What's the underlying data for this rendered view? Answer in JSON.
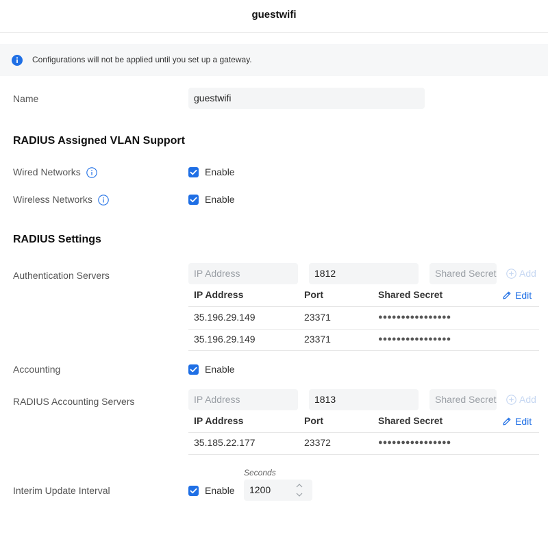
{
  "header": {
    "title": "guestwifi"
  },
  "notice": {
    "message": "Configurations will not be applied until you set up a gateway.",
    "icon": "info-icon",
    "color": "#1f6fe5"
  },
  "name": {
    "label": "Name",
    "value": "guestwifi"
  },
  "vlan": {
    "section_title": "RADIUS Assigned VLAN Support",
    "wired": {
      "label": "Wired Networks",
      "enable_label": "Enable",
      "checked": true
    },
    "wireless": {
      "label": "Wireless Networks",
      "enable_label": "Enable",
      "checked": true
    }
  },
  "radius": {
    "section_title": "RADIUS Settings",
    "auth": {
      "label": "Authentication Servers",
      "ip_placeholder": "IP Address",
      "port_value": "1812",
      "secret_placeholder": "Shared Secret",
      "add_label": "Add",
      "edit_label": "Edit",
      "columns": [
        "IP Address",
        "Port",
        "Shared Secret"
      ],
      "rows": [
        {
          "ip": "35.196.29.149",
          "port": "23371",
          "secret": "●●●●●●●●●●●●●●●●"
        },
        {
          "ip": "35.196.29.149",
          "port": "23371",
          "secret": "●●●●●●●●●●●●●●●●"
        }
      ]
    },
    "accounting": {
      "label": "Accounting",
      "enable_label": "Enable",
      "checked": true
    },
    "acct_servers": {
      "label": "RADIUS Accounting Servers",
      "ip_placeholder": "IP Address",
      "port_value": "1813",
      "secret_placeholder": "Shared Secret",
      "add_label": "Add",
      "edit_label": "Edit",
      "columns": [
        "IP Address",
        "Port",
        "Shared Secret"
      ],
      "rows": [
        {
          "ip": "35.185.22.177",
          "port": "23372",
          "secret": "●●●●●●●●●●●●●●●●"
        }
      ]
    },
    "interim": {
      "label": "Interim Update Interval",
      "enable_label": "Enable",
      "checked": true,
      "seconds_label": "Seconds",
      "value": "1200"
    }
  }
}
